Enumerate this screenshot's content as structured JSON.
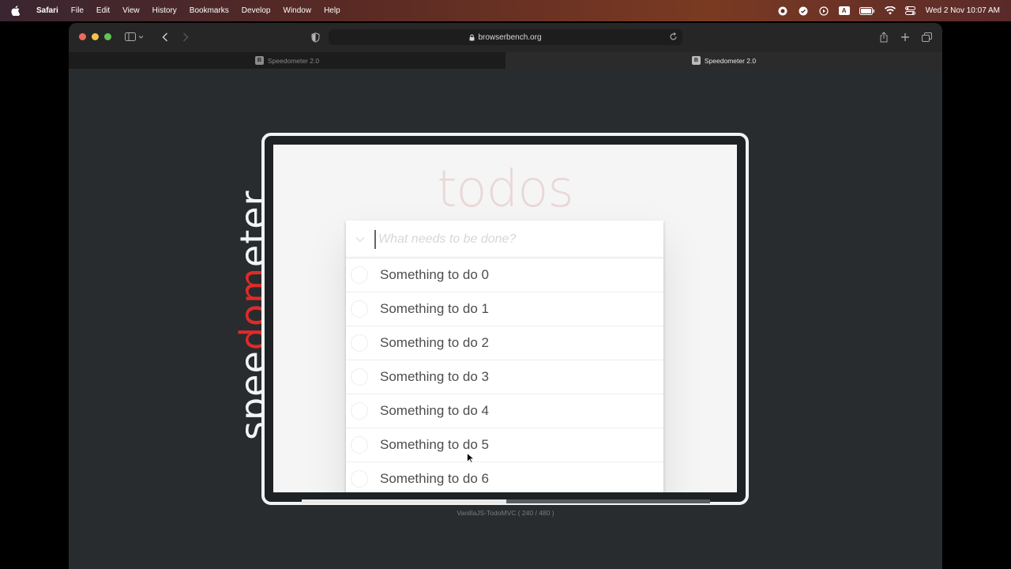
{
  "menubar": {
    "app": "Safari",
    "items": [
      "File",
      "Edit",
      "View",
      "History",
      "Bookmarks",
      "Develop",
      "Window",
      "Help"
    ],
    "clock": "Wed 2 Nov  10:07 AM",
    "status_icons": [
      "record-icon",
      "checkmark-icon",
      "play-icon",
      "input-source-icon",
      "battery-icon",
      "wifi-icon",
      "control-center-icon"
    ],
    "input_source": "A"
  },
  "browser": {
    "url": "browserbench.org",
    "tabs": [
      {
        "label": "Speedometer 2.0",
        "favicon": "B",
        "active": false
      },
      {
        "label": "Speedometer 2.0",
        "favicon": "B",
        "active": true
      }
    ]
  },
  "benchmark": {
    "logo_prefix": "spee",
    "logo_highlight": "dom",
    "logo_suffix": "eter",
    "caption": "VanillaJS-TodoMVC ( 240 / 480 )",
    "progress": 0.5
  },
  "todo": {
    "title": "todos",
    "placeholder": "What needs to be done?",
    "items": [
      "Something to do 0",
      "Something to do 1",
      "Something to do 2",
      "Something to do 3",
      "Something to do 4",
      "Something to do 5",
      "Something to do 6"
    ]
  },
  "colors": {
    "accent_red": "#e12a2a",
    "window_bg": "#282c2e"
  }
}
